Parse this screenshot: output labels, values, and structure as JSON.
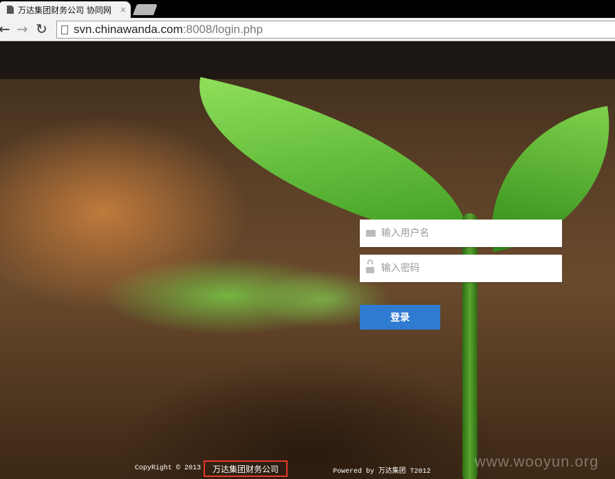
{
  "browser": {
    "tab_title": "万达集团财务公司 协同网",
    "tab_close": "×",
    "url_host": "svn.chinawanda.com",
    "url_port": ":8008",
    "url_path": "/login.php"
  },
  "nav": {
    "back": "←",
    "forward": "→",
    "reload": "↻"
  },
  "login": {
    "username_placeholder": "输入用户名",
    "password_placeholder": "输入密码",
    "submit_label": "登录"
  },
  "footer": {
    "copyright": "CopyRight © 2013",
    "company": "万达集团财务公司",
    "powered": "Powered by 万达集团 T2012",
    "watermark": "www.wooyun.org"
  },
  "icons": {
    "username": "mail-icon",
    "password": "lock-icon"
  },
  "colors": {
    "button": "#2f7bd1",
    "highlight_box": "#e83a2e"
  }
}
